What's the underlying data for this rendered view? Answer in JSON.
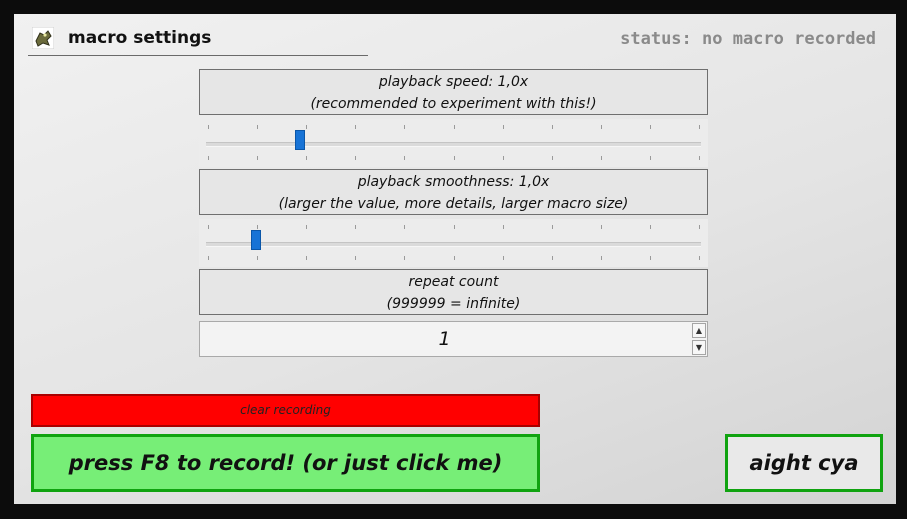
{
  "header": {
    "title": "macro settings",
    "status": "status: no macro recorded",
    "icon": "robot-icon"
  },
  "playback_speed": {
    "line1": "playback speed: 1,0x",
    "line2": "(recommended to experiment with this!)",
    "slider_position": 0.19
  },
  "playback_smoothness": {
    "line1": "playback smoothness: 1,0x",
    "line2": "(larger the value, more details, larger macro size)",
    "slider_position": 0.1
  },
  "repeat": {
    "line1": "repeat count",
    "line2": "(999999 = infinite)",
    "value": "1",
    "up_icon": "spin-up-icon",
    "down_icon": "spin-down-icon"
  },
  "buttons": {
    "clear": "clear recording",
    "record": "press F8 to record! (or just click me)",
    "exit": "aight cya"
  },
  "colors": {
    "slider_thumb": "#1773d6",
    "clear_button": "#ff0000",
    "record_button": "#77ee77",
    "button_border": "#10a310",
    "status_text": "#8a8a8a"
  }
}
